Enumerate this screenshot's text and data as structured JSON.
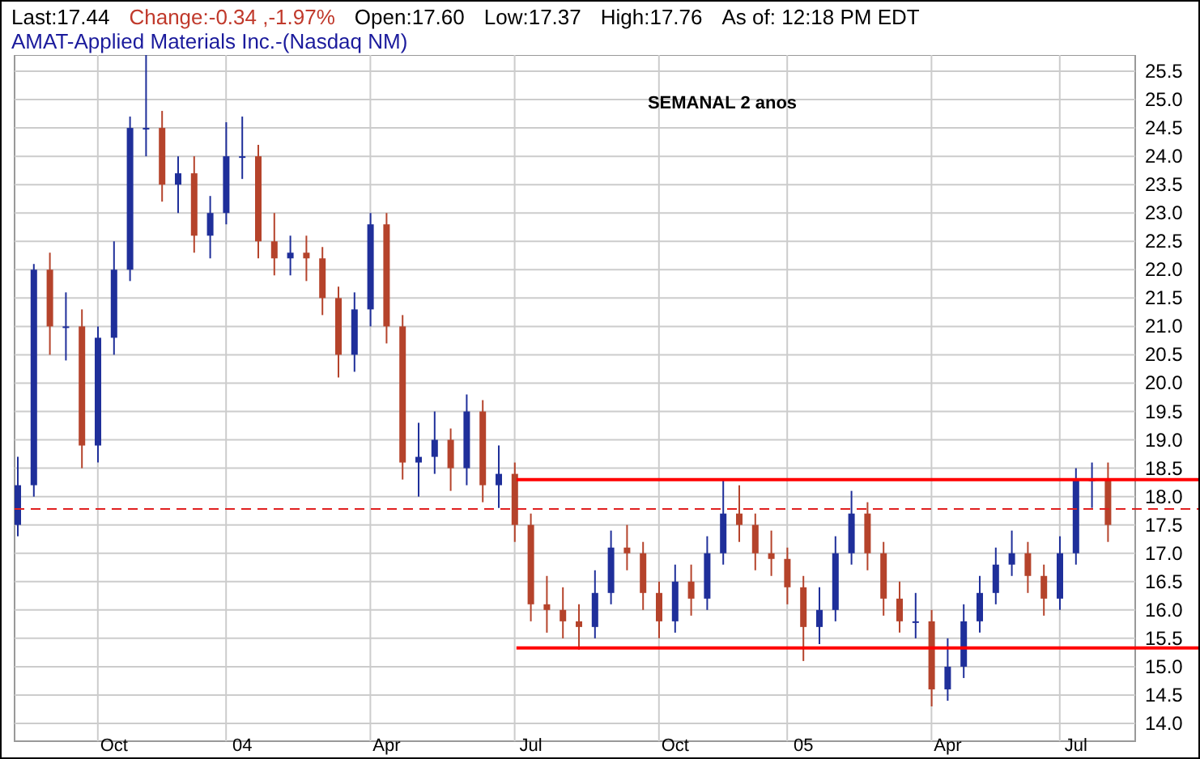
{
  "quote": [
    {
      "kind": "plain",
      "text": "Last:17.44"
    },
    {
      "kind": "change",
      "text": "Change:-0.34 ,-1.97%"
    },
    {
      "kind": "plain",
      "text": "Open:17.60"
    },
    {
      "kind": "plain",
      "text": "Low:17.37"
    },
    {
      "kind": "plain",
      "text": "High:17.76"
    },
    {
      "kind": "plain",
      "text": "As of: 12:18 PM EDT"
    }
  ],
  "symbol_title": "AMAT-Applied Materials Inc.-(Nasdaq NM)",
  "chart": {
    "chart_data": {
      "type": "candlestick",
      "ylim": [
        14,
        25.5
      ],
      "grid": true,
      "annotations": [
        {
          "text": "SEMANAL 2 anos"
        }
      ],
      "ref_lines": [
        {
          "axis": "y",
          "value": 17.78,
          "color": "#e02020"
        },
        {
          "axis": "y",
          "value": 18.3,
          "color": "#ff0000"
        },
        {
          "axis": "y",
          "value": 15.33,
          "color": "#ff0000"
        }
      ],
      "categories": [
        null,
        null,
        null,
        null,
        null,
        null,
        "Oct",
        null,
        null,
        null,
        null,
        null,
        null,
        null,
        "04",
        null,
        null,
        null,
        null,
        null,
        null,
        null,
        null,
        "Apr",
        null,
        null,
        null,
        null,
        null,
        null,
        null,
        null,
        "Jul",
        null,
        null,
        null,
        null,
        null,
        null,
        null,
        null,
        "Oct",
        null,
        null,
        null,
        null,
        null,
        null,
        null,
        "05",
        null,
        null,
        null,
        null,
        null,
        null,
        null,
        null,
        "Apr",
        null,
        null,
        null,
        null,
        null,
        null,
        null,
        "Jul",
        null,
        null
      ],
      "yticks": [
        {
          "value": 25.5,
          "label": "25.5"
        },
        {
          "value": 25,
          "label": "25.0"
        },
        {
          "value": 24.5,
          "label": "24.5"
        },
        {
          "value": 24,
          "label": "24.0"
        },
        {
          "value": 23.5,
          "label": "23.5"
        },
        {
          "value": 23,
          "label": "23.0"
        },
        {
          "value": 22.5,
          "label": "22.5"
        },
        {
          "value": 22,
          "label": "22.0"
        },
        {
          "value": 21.5,
          "label": "21.5"
        },
        {
          "value": 21,
          "label": "21.0"
        },
        {
          "value": 20.5,
          "label": "20.5"
        },
        {
          "value": 20,
          "label": "20.0"
        },
        {
          "value": 19.5,
          "label": "19.5"
        },
        {
          "value": 19,
          "label": "19.0"
        },
        {
          "value": 18.5,
          "label": "18.5"
        },
        {
          "value": 18,
          "label": "18.0"
        },
        {
          "value": 17.5,
          "label": "17.5"
        },
        {
          "value": 17,
          "label": "17.0"
        },
        {
          "value": 16.5,
          "label": "16.5"
        },
        {
          "value": 16,
          "label": "16.0"
        },
        {
          "value": 15.5,
          "label": "15.5"
        },
        {
          "value": 15,
          "label": "15.0"
        },
        {
          "value": 14.5,
          "label": "14.5"
        },
        {
          "value": 14,
          "label": "14.0"
        }
      ],
      "ohlc": [
        [
          17.5,
          18.7,
          17.3,
          18.2
        ],
        [
          18.2,
          22.1,
          18.0,
          22.0
        ],
        [
          22.0,
          22.3,
          20.5,
          21.0
        ],
        [
          21.0,
          21.6,
          20.4,
          21.0
        ],
        [
          21.0,
          21.3,
          18.5,
          18.9
        ],
        [
          18.9,
          21.0,
          18.6,
          20.8
        ],
        [
          20.8,
          22.5,
          20.5,
          22.0
        ],
        [
          22.0,
          24.7,
          21.8,
          24.5
        ],
        [
          24.5,
          25.8,
          24.0,
          24.5
        ],
        [
          24.5,
          24.8,
          23.2,
          23.5
        ],
        [
          23.5,
          24.0,
          23.0,
          23.7
        ],
        [
          23.7,
          24.0,
          22.3,
          22.6
        ],
        [
          22.6,
          23.3,
          22.2,
          23.0
        ],
        [
          23.0,
          24.6,
          22.8,
          24.0
        ],
        [
          24.0,
          24.7,
          23.6,
          24.0
        ],
        [
          24.0,
          24.2,
          22.2,
          22.5
        ],
        [
          22.5,
          23.0,
          21.9,
          22.2
        ],
        [
          22.2,
          22.6,
          21.9,
          22.3
        ],
        [
          22.3,
          22.6,
          21.8,
          22.2
        ],
        [
          22.2,
          22.4,
          21.2,
          21.5
        ],
        [
          21.5,
          21.7,
          20.1,
          20.5
        ],
        [
          20.5,
          21.6,
          20.2,
          21.3
        ],
        [
          21.3,
          23.0,
          21.0,
          22.8
        ],
        [
          22.8,
          23.0,
          20.7,
          21.0
        ],
        [
          21.0,
          21.2,
          18.3,
          18.6
        ],
        [
          18.6,
          19.3,
          18.0,
          18.7
        ],
        [
          18.7,
          19.5,
          18.4,
          19.0
        ],
        [
          19.0,
          19.2,
          18.1,
          18.5
        ],
        [
          18.5,
          19.8,
          18.2,
          19.5
        ],
        [
          19.5,
          19.7,
          17.9,
          18.2
        ],
        [
          18.2,
          18.9,
          17.8,
          18.4
        ],
        [
          18.4,
          18.6,
          17.2,
          17.5
        ],
        [
          17.5,
          17.7,
          15.8,
          16.1
        ],
        [
          16.1,
          16.6,
          15.6,
          16.0
        ],
        [
          16.0,
          16.4,
          15.5,
          15.8
        ],
        [
          15.8,
          16.1,
          15.3,
          15.7
        ],
        [
          15.7,
          16.7,
          15.5,
          16.3
        ],
        [
          16.3,
          17.4,
          16.1,
          17.1
        ],
        [
          17.1,
          17.5,
          16.7,
          17.0
        ],
        [
          17.0,
          17.2,
          16.0,
          16.3
        ],
        [
          16.3,
          16.5,
          15.5,
          15.8
        ],
        [
          15.8,
          16.8,
          15.6,
          16.5
        ],
        [
          16.5,
          16.8,
          15.9,
          16.2
        ],
        [
          16.2,
          17.3,
          16.0,
          17.0
        ],
        [
          17.0,
          18.3,
          16.8,
          17.7
        ],
        [
          17.7,
          18.2,
          17.2,
          17.5
        ],
        [
          17.5,
          17.7,
          16.7,
          17.0
        ],
        [
          17.0,
          17.4,
          16.6,
          16.9
        ],
        [
          16.9,
          17.1,
          16.1,
          16.4
        ],
        [
          16.4,
          16.6,
          15.1,
          15.7
        ],
        [
          15.7,
          16.4,
          15.4,
          16.0
        ],
        [
          16.0,
          17.3,
          15.8,
          17.0
        ],
        [
          17.0,
          18.1,
          16.8,
          17.7
        ],
        [
          17.7,
          17.9,
          16.7,
          17.0
        ],
        [
          17.0,
          17.2,
          15.9,
          16.2
        ],
        [
          16.2,
          16.5,
          15.6,
          15.8
        ],
        [
          15.8,
          16.3,
          15.5,
          15.8
        ],
        [
          15.8,
          16.0,
          14.3,
          14.6
        ],
        [
          14.6,
          15.5,
          14.4,
          15.0
        ],
        [
          15.0,
          16.1,
          14.8,
          15.8
        ],
        [
          15.8,
          16.6,
          15.6,
          16.3
        ],
        [
          16.3,
          17.1,
          16.1,
          16.8
        ],
        [
          16.8,
          17.4,
          16.6,
          17.0
        ],
        [
          17.0,
          17.2,
          16.3,
          16.6
        ],
        [
          16.6,
          16.8,
          15.9,
          16.2
        ],
        [
          16.2,
          17.3,
          16.0,
          17.0
        ],
        [
          17.0,
          18.5,
          16.8,
          18.3
        ],
        [
          18.3,
          18.6,
          17.8,
          18.3
        ],
        [
          18.3,
          18.6,
          17.2,
          17.5
        ]
      ]
    }
  }
}
